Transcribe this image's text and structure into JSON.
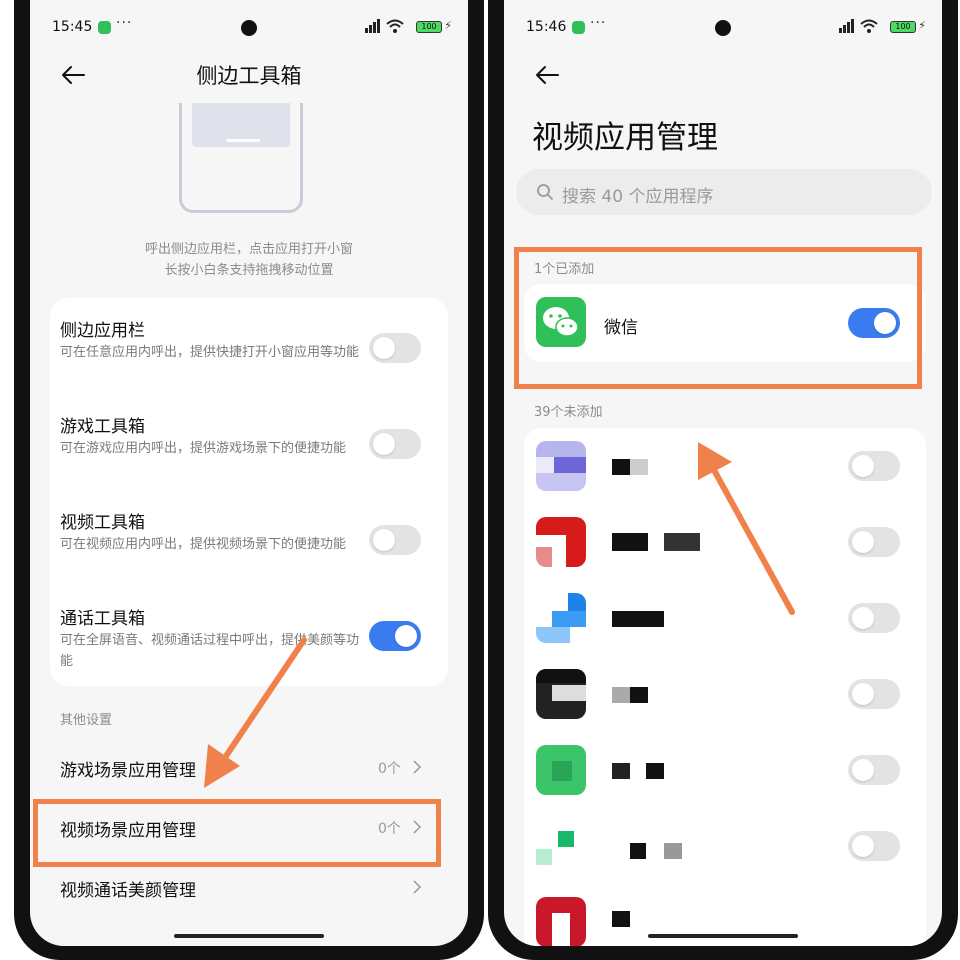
{
  "left": {
    "status": {
      "time": "15:45",
      "dots": "···",
      "battery": "100"
    },
    "title": "侧边工具箱",
    "description": [
      "呼出侧边应用栏，点击应用打开小窗",
      "长按小白条支持拖拽移动位置"
    ],
    "toggles": [
      {
        "title": "侧边应用栏",
        "subtitle": "可在任意应用内呼出，提供快捷打开小窗应用等功能",
        "on": false
      },
      {
        "title": "游戏工具箱",
        "subtitle": "可在游戏应用内呼出，提供游戏场景下的便捷功能",
        "on": false
      },
      {
        "title": "视频工具箱",
        "subtitle": "可在视频应用内呼出，提供视频场景下的便捷功能",
        "on": false
      },
      {
        "title": "通话工具箱",
        "subtitle": "可在全屏语音、视频通话过程中呼出，提供美颜等功能",
        "on": true
      }
    ],
    "other_label": "其他设置",
    "rows": [
      {
        "title": "游戏场景应用管理",
        "count": "0个"
      },
      {
        "title": "视频场景应用管理",
        "count": "0个"
      },
      {
        "title": "视频通话美颜管理",
        "count": ""
      }
    ]
  },
  "right": {
    "status": {
      "time": "15:46",
      "dots": "···",
      "battery": "100"
    },
    "title": "视频应用管理",
    "search_placeholder": "搜索 40 个应用程序",
    "added_label": "1个已添加",
    "added_app": {
      "name": "微信",
      "on": true
    },
    "not_added_label": "39个未添加"
  },
  "colors": {
    "accent": "#3a7cf0",
    "highlight": "#f0814a",
    "wechat": "#2fc05a"
  }
}
